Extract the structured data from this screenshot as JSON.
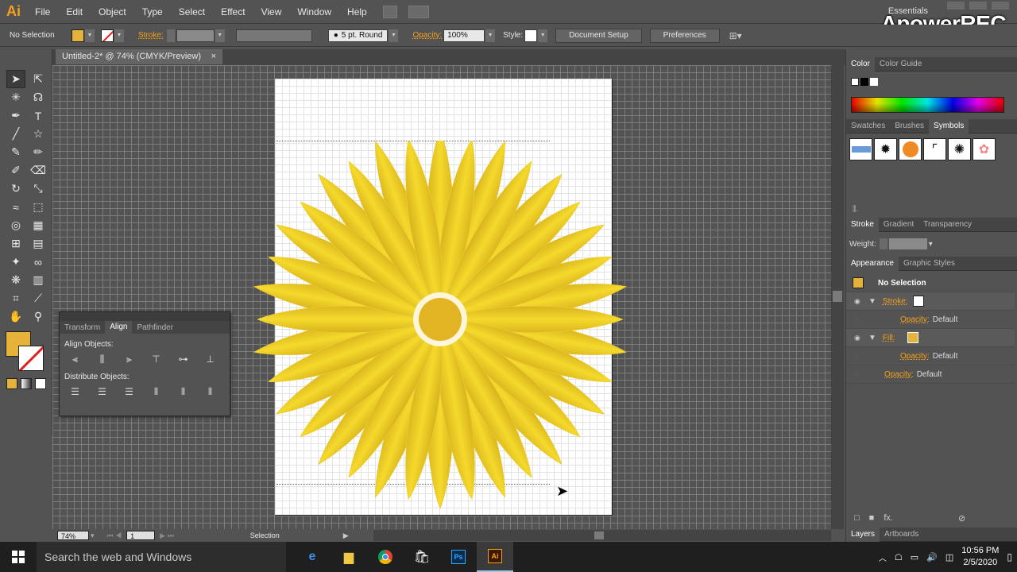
{
  "app": {
    "logo": "Ai",
    "essentials": "Essentials",
    "watermark": "ApowerREC"
  },
  "menu": [
    "File",
    "Edit",
    "Object",
    "Type",
    "Select",
    "Effect",
    "View",
    "Window",
    "Help"
  ],
  "control": {
    "selection": "No Selection",
    "stroke_label": "Stroke:",
    "brush": "5 pt. Round",
    "opacity_label": "Opacity:",
    "opacity_value": "100%",
    "style_label": "Style:",
    "document_setup": "Document Setup",
    "preferences": "Preferences"
  },
  "document": {
    "tab_title": "Untitled-2* @ 74% (CMYK/Preview)",
    "close": "×"
  },
  "status": {
    "zoom": "74%",
    "artboard": "1",
    "tool": "Selection"
  },
  "align_panel": {
    "tabs": [
      "Transform",
      "Align",
      "Pathfinder"
    ],
    "active_tab": "Align",
    "align_objects": "Align Objects:",
    "distribute_objects": "Distribute Objects:"
  },
  "right_panel": {
    "color_tabs": [
      "Color",
      "Color Guide"
    ],
    "symbol_tabs": [
      "Swatches",
      "Brushes",
      "Symbols"
    ],
    "stroke_tabs": [
      "Stroke",
      "Gradient",
      "Transparency"
    ],
    "weight_label": "Weight:",
    "appearance_tabs": [
      "Appearance",
      "Graphic Styles"
    ],
    "appearance": {
      "title": "No Selection",
      "stroke": "Stroke:",
      "fill": "Fill:",
      "opacity_label": "Opacity:",
      "opacity_default": "Default"
    },
    "layers_tabs": [
      "Layers",
      "Artboards"
    ]
  },
  "taskbar": {
    "search_placeholder": "Search the web and Windows",
    "time": "10:56 PM",
    "date": "2/5/2020"
  },
  "colors": {
    "fill": "#e6b33a",
    "accent": "#f7a11a",
    "petal": "#f2d32a",
    "petal_dark": "#d9b21a",
    "center": "#e2b322"
  }
}
